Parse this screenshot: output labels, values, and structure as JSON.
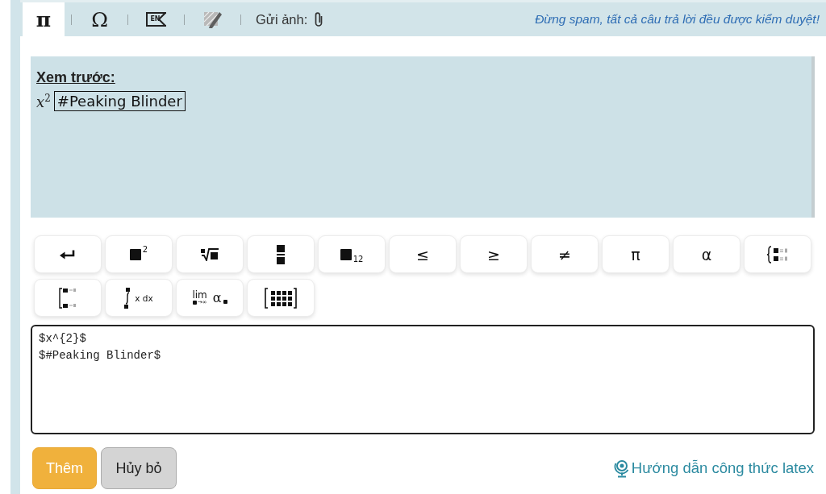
{
  "toolbar": {
    "tabs": [
      {
        "kind": "char",
        "label": "π",
        "selected": true
      },
      {
        "kind": "char",
        "label": "Ω",
        "selected": false
      },
      {
        "kind": "tag",
        "label": "EN",
        "selected": false
      },
      {
        "kind": "pencil",
        "selected": false
      }
    ],
    "attach": {
      "label": "Gửi ảnh:"
    },
    "notice": "Đừng spam, tất cả câu trả lời đều được kiểm duyệt!"
  },
  "preview": {
    "title": "Xem trước:",
    "items": [
      {
        "kind": "math",
        "text": "*x*$^{2}$"
      },
      {
        "kind": "boxed",
        "text": "#Peaking Blinder"
      }
    ]
  },
  "keypad": {
    "rows": [
      [
        {
          "kind": "enter"
        },
        {
          "kind": "power",
          "label": "2"
        },
        {
          "kind": "root"
        },
        {
          "kind": "fraction"
        },
        {
          "kind": "subscript",
          "label": "12"
        },
        {
          "kind": "char",
          "label": "≤"
        },
        {
          "kind": "char",
          "label": "≥"
        },
        {
          "kind": "char",
          "label": "≠"
        },
        {
          "kind": "char",
          "label": "π"
        },
        {
          "kind": "char",
          "label": "α"
        },
        {
          "kind": "cases"
        }
      ],
      [
        {
          "kind": "bracket"
        },
        {
          "kind": "integral",
          "label": "x dx"
        },
        {
          "kind": "limit",
          "label": "lim",
          "under": "→∞",
          "symbol": "α"
        },
        {
          "kind": "matrix"
        }
      ]
    ]
  },
  "editor": {
    "value": "$x^{2}$ \n$#Peaking Blinder$"
  },
  "actions": {
    "buttons": [
      {
        "kind": "primary",
        "label": "Thêm"
      },
      {
        "kind": "secondary",
        "label": "Hủy bỏ"
      }
    ],
    "help_link": "Hướng dẫn công thức latex"
  }
}
